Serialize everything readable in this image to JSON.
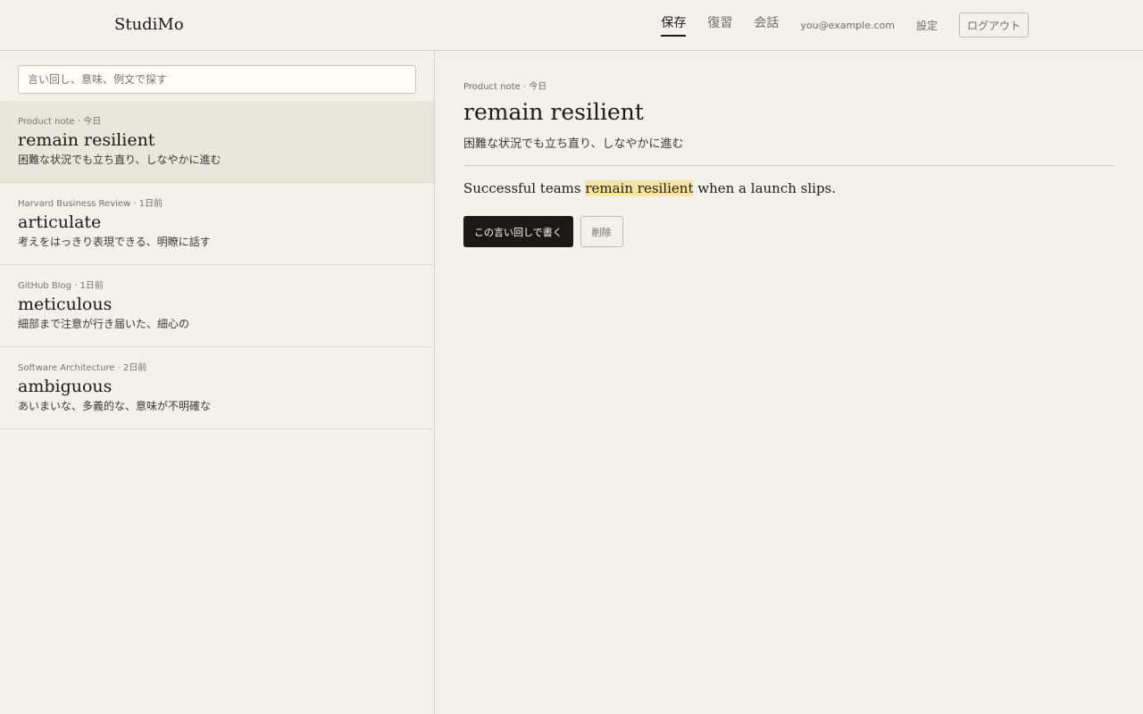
{
  "app": {
    "brand": "StudiMo"
  },
  "nav": {
    "tabs": [
      {
        "label": "保存",
        "active": true
      },
      {
        "label": "復習",
        "active": false
      },
      {
        "label": "会話",
        "active": false
      }
    ],
    "email": "you@example.com",
    "settings": "設定",
    "logout": "ログアウト"
  },
  "search": {
    "placeholder": "言い回し、意味、例文で探す",
    "value": ""
  },
  "entries": [
    {
      "meta": "Product note · 今日",
      "term": "remain resilient",
      "gloss": "困難な状況でも立ち直り、しなやかに進む",
      "selected": true
    },
    {
      "meta": "Harvard Business Review · 1日前",
      "term": "articulate",
      "gloss": "考えをはっきり表現できる、明瞭に話す",
      "selected": false
    },
    {
      "meta": "GitHub Blog · 1日前",
      "term": "meticulous",
      "gloss": "細部まで注意が行き届いた、細心の",
      "selected": false
    },
    {
      "meta": "Software Architecture · 2日前",
      "term": "ambiguous",
      "gloss": "あいまいな、多義的な、意味が不明確な",
      "selected": false
    }
  ],
  "detail": {
    "meta": "Product note · 今日",
    "term": "remain resilient",
    "gloss": "困難な状況でも立ち直り、しなやかに進む",
    "example": {
      "before": "Successful teams ",
      "highlight": "remain resilient",
      "after": " when a launch slips."
    },
    "write_button": "この言い回しで書く",
    "delete_button": "削除"
  },
  "colors": {
    "background": "#f4f1ea",
    "selected_row": "#ebe6dc",
    "highlight": "#fae39a",
    "primary_button": "#1c1915"
  }
}
